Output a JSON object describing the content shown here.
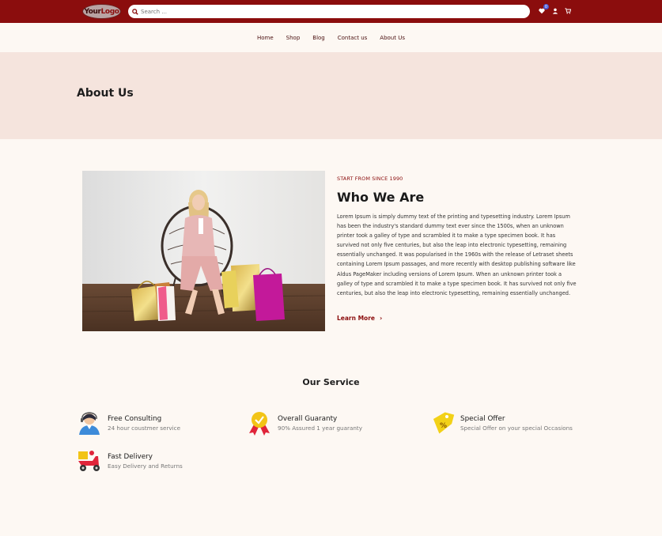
{
  "header": {
    "logo_part1": "Your",
    "logo_part2": "Logo",
    "search_placeholder": "Search ...",
    "wishlist_count": "0"
  },
  "nav": {
    "items": [
      "Home",
      "Shop",
      "Blog",
      "Contact us",
      "About Us"
    ]
  },
  "hero": {
    "title": "About Us"
  },
  "about": {
    "kicker": "START FROM SINCE 1990",
    "heading": "Who We Are",
    "paragraph": "Lorem Ipsum is simply dummy text of the printing and typesetting industry. Lorem Ipsum has been the industry's standard dummy text ever since the 1500s, when an unknown printer took a galley of type and scrambled it to make a type specimen book. It has survived not only five centuries, but also the leap into electronic typesetting, remaining essentially unchanged. It was popularised in the 1960s with the release of Letraset sheets containing Lorem Ipsum passages, and more recently with desktop publishing software like Aldus PageMaker including versions of Lorem Ipsum. When an unknown printer took a galley of type and scrambled it to make a type specimen book. It has survived not only five centuries, but also the leap into electronic typesetting, remaining essentially unchanged.",
    "learn_more": "Learn More",
    "chevron": "›"
  },
  "services": {
    "title": "Our Service",
    "items": [
      {
        "title": "Free Consulting",
        "subtitle": "24 hour coustmer service",
        "icon": "support-agent-icon"
      },
      {
        "title": "Overall Guaranty",
        "subtitle": "90% Assured 1 year guaranty",
        "icon": "guarantee-badge-icon"
      },
      {
        "title": "Special Offer",
        "subtitle": "Special Offer on your special  Occasions",
        "icon": "discount-tag-icon"
      },
      {
        "title": "Fast Delivery",
        "subtitle": "Easy Delivery and Returns",
        "icon": "delivery-scooter-icon"
      }
    ]
  },
  "colors": {
    "brand": "#8b0d0d",
    "hero_bg": "#f5e4dd",
    "page_bg": "#fdf8f3"
  }
}
